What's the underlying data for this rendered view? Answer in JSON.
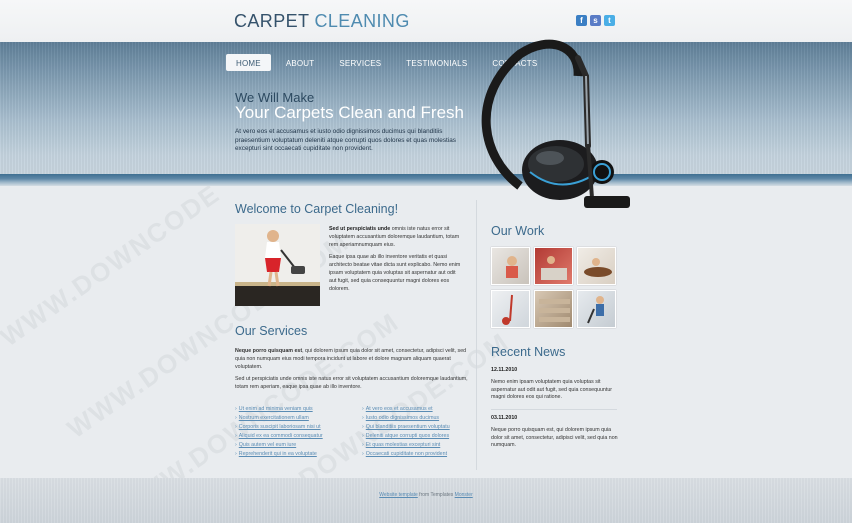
{
  "header": {
    "brand_part1": "CARPET",
    "brand_part2": "CLEANING",
    "social": [
      {
        "icon": "facebook-icon",
        "glyph": "f",
        "color": "#3b7fc4"
      },
      {
        "icon": "skype-icon",
        "glyph": "s",
        "color": "#5a7cc6"
      },
      {
        "icon": "twitter-icon",
        "glyph": "t",
        "color": "#4aaee6"
      }
    ]
  },
  "nav": {
    "items": [
      "HOME",
      "ABOUT",
      "SERVICES",
      "TESTIMONIALS",
      "CONTACTS"
    ],
    "active": "HOME"
  },
  "hero": {
    "subtitle": "We Will Make",
    "title": "Your Carpets Clean and Fresh",
    "text": "At vero eos et accusamus et iusto odio dignissimos ducimus qui blanditiis praesentium voluptatum deleniti atque corrupti quos dolores et quas molestias excepturi sint occaecati cupiditate non provident."
  },
  "welcome": {
    "heading": "Welcome to Carpet Cleaning!",
    "lead_bold": "Sed ut perspiciatis unde",
    "lead_rest": " omnis iste natus error sit voluptatem accusantium doloremque laudantium, totam rem aperiamnumquam eius.",
    "para2": "Eaque ipsa quae ab illo inventore veritatis et quasi architecto beatae vitae dicta sunt explicabo. Nemo enim ipsam voluptatem quia voluptas sit aspernatur aut odit aut fugit, sed quia consequuntur magni dolores eos dolorem."
  },
  "services": {
    "heading": "Our Services",
    "lead_bold": "Neque porro quisquam est",
    "lead_rest": ", qui dolorem ipsum quia dolor sit amet, consectetur, adipisci velit, sed quia non numquam eius modi tempora incidunt ut labore et dolore magnam aliquam quaerat voluptatem.",
    "para2": "Sed ut perspiciatis unde omnis iste natus error sit voluptatem accusantium doloremque laudantium, totam rem aperiam, eaque ipsa quae ab illo inventore.",
    "list_left": [
      "Ut enim ad minima veniam quis",
      "Nostrum exercitationem ullam",
      "Corporis suscipit laboriosam nisi ut",
      "Aliquid ex ea commodi consequatur",
      "Quis autem vel eum iure",
      "Reprehenderit qui in ea voluptate"
    ],
    "list_right": [
      "At vero eos et accusamus et",
      "Iusto odio dignissimos ducimus",
      "Qui blanditiis praesentium voluptatu",
      "Deleniti atque corrupti quos dolores",
      "Et quas molestias excepturi sint",
      "Occaecati cupiditate non provident"
    ]
  },
  "work": {
    "heading": "Our Work"
  },
  "news": {
    "heading": "Recent News",
    "items": [
      {
        "date": "12.11.2010",
        "text": "Nemo enim ipsam voluptatem quia voluptas sit aspernatur aut odit aut fugit, sed quia consequuntur magni dolores eos qui ratione."
      },
      {
        "date": "03.11.2010",
        "text": "Neque porro quisquam est, qui dolorem ipsum quia dolor sit amet, consectetur, adipisci velit, sed quia non numquam."
      }
    ]
  },
  "footer": {
    "link1": "Website template",
    "middle": " from Templates ",
    "link2": "Monster"
  }
}
